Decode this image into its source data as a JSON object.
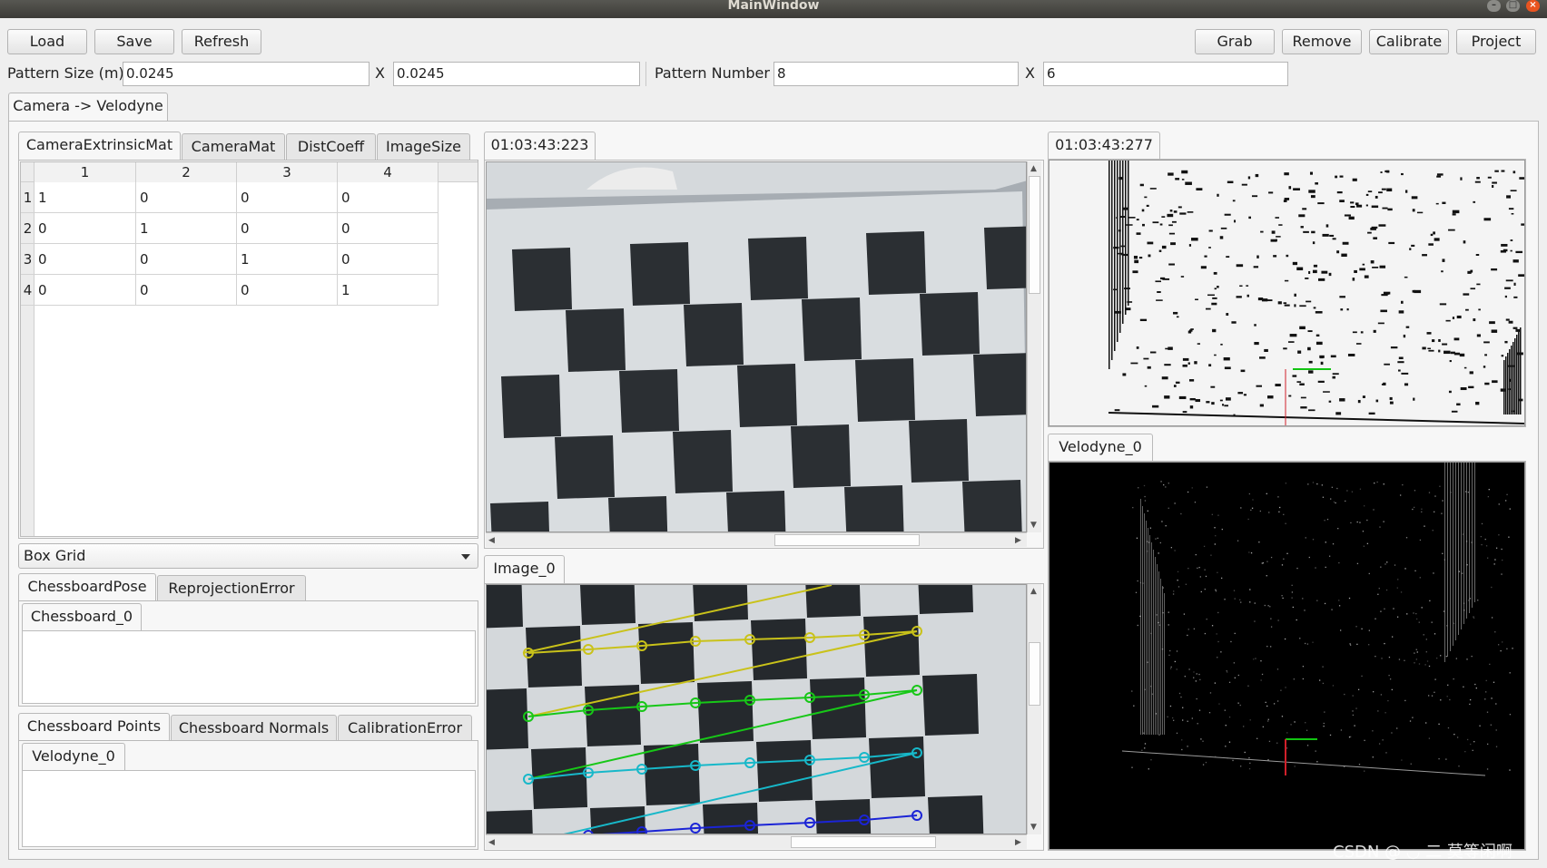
{
  "window": {
    "title": "MainWindow"
  },
  "toolbar": {
    "load": "Load",
    "save": "Save",
    "refresh": "Refresh",
    "grab": "Grab",
    "remove": "Remove",
    "calibrate": "Calibrate",
    "project": "Project"
  },
  "pattern": {
    "size_label": "Pattern Size (m)",
    "size_x": "0.0245",
    "x_sep": "X",
    "size_y": "0.0245",
    "number_label": "Pattern Number",
    "number_x": "8",
    "number_y": "6"
  },
  "main_tab": "Camera -> Velodyne",
  "matrix_tabs": [
    "CameraExtrinsicMat",
    "CameraMat",
    "DistCoeff",
    "ImageSize"
  ],
  "matrix": {
    "col_headers": [
      "1",
      "2",
      "3",
      "4"
    ],
    "row_headers": [
      "1",
      "2",
      "3",
      "4"
    ],
    "rows": [
      [
        "1",
        "0",
        "0",
        "0"
      ],
      [
        "0",
        "1",
        "0",
        "0"
      ],
      [
        "0",
        "0",
        "1",
        "0"
      ],
      [
        "0",
        "0",
        "0",
        "1"
      ]
    ]
  },
  "combo": {
    "value": "Box Grid"
  },
  "pose_tabs": [
    "ChessboardPose",
    "ReprojectionError"
  ],
  "pose_subtab": "Chessboard_0",
  "points_tabs": [
    "Chessboard Points",
    "Chessboard Normals",
    "CalibrationError"
  ],
  "points_subtab": "Velodyne_0",
  "camera_view": {
    "timestamp": "01:03:43:223"
  },
  "image_view": {
    "tab": "Image_0"
  },
  "lidar_view": {
    "timestamp": "01:03:43:277"
  },
  "velodyne_view": {
    "tab": "Velodyne_0"
  },
  "watermark": "CSDN @ ◡ 二 莫等闲啊",
  "colors": {
    "accent_close": "#e95420",
    "chess_dark": "#2b2f33"
  }
}
